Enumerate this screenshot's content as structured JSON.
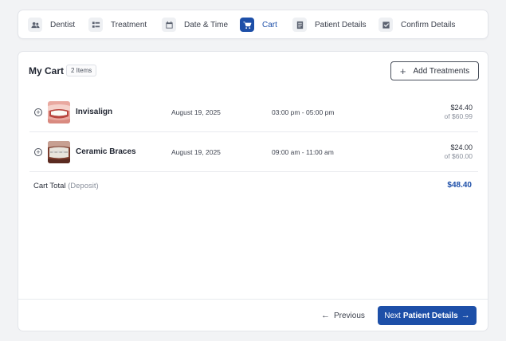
{
  "steps": [
    {
      "label": "Dentist",
      "icon": "users-icon"
    },
    {
      "label": "Treatment",
      "icon": "list-icon"
    },
    {
      "label": "Date & Time",
      "icon": "calendar-icon"
    },
    {
      "label": "Cart",
      "icon": "cart-icon",
      "active": true
    },
    {
      "label": "Patient Details",
      "icon": "document-icon"
    },
    {
      "label": "Confirm Details",
      "icon": "checkbox-icon"
    }
  ],
  "cart": {
    "title": "My Cart",
    "items_badge": "2 Items",
    "add_button": "Add Treatments",
    "items": [
      {
        "name": "Invisalign",
        "date": "August 19, 2025",
        "time": "03:00 pm - 05:00 pm",
        "price": "$24.40",
        "of_price": "of $60.99"
      },
      {
        "name": "Ceramic Braces",
        "date": "August 19, 2025",
        "time": "09:00 am - 11:00 am",
        "price": "$24.00",
        "of_price": "of $60.00"
      }
    ],
    "total_label": "Cart Total",
    "total_note": "(Deposit)",
    "total_value": "$48.40"
  },
  "footer": {
    "previous_label": "Previous",
    "next_prefix": "Next",
    "next_bold": "Patient Details"
  },
  "colors": {
    "accent": "#1d4fa8"
  }
}
